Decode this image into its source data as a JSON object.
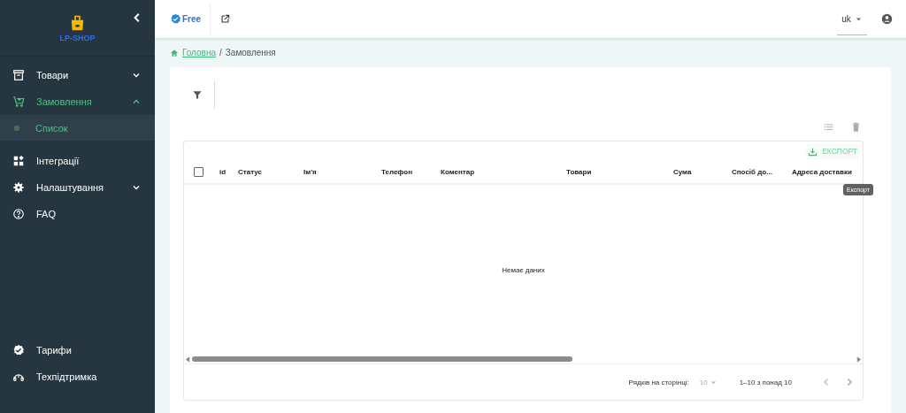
{
  "sidebar": {
    "logo": "LP-SHOP",
    "items": [
      {
        "label": "Товари",
        "expanded": false
      },
      {
        "label": "Замовлення",
        "expanded": true,
        "children": [
          {
            "label": "Список",
            "selected": true
          }
        ]
      },
      {
        "label": "Інтеграції"
      },
      {
        "label": "Налаштування",
        "expanded": false
      },
      {
        "label": "FAQ"
      }
    ],
    "bottom_items": [
      {
        "label": "Тарифи"
      },
      {
        "label": "Техпідтримка"
      }
    ]
  },
  "topbar": {
    "plan": "Free",
    "language": "uk"
  },
  "breadcrumb": [
    {
      "label": "Головна",
      "kind": "link"
    },
    {
      "label": "/",
      "kind": "separator"
    },
    {
      "label": "Замовлення",
      "kind": "current"
    }
  ],
  "table": {
    "export_button": "ЕКСПОРТ",
    "tooltip": "Експорт",
    "select_all_checked": false,
    "columns": [
      "id",
      "Статус",
      "Ім'я",
      "Телефон",
      "Коментар",
      "Товари",
      "Сума",
      "Спосіб до...",
      "Адреса доставки"
    ],
    "empty_text": "Немає даних",
    "pagination": {
      "rows_label": "Рядків на сторінці:",
      "rows_value": "10",
      "range": "1–10 з понад 10"
    }
  }
}
